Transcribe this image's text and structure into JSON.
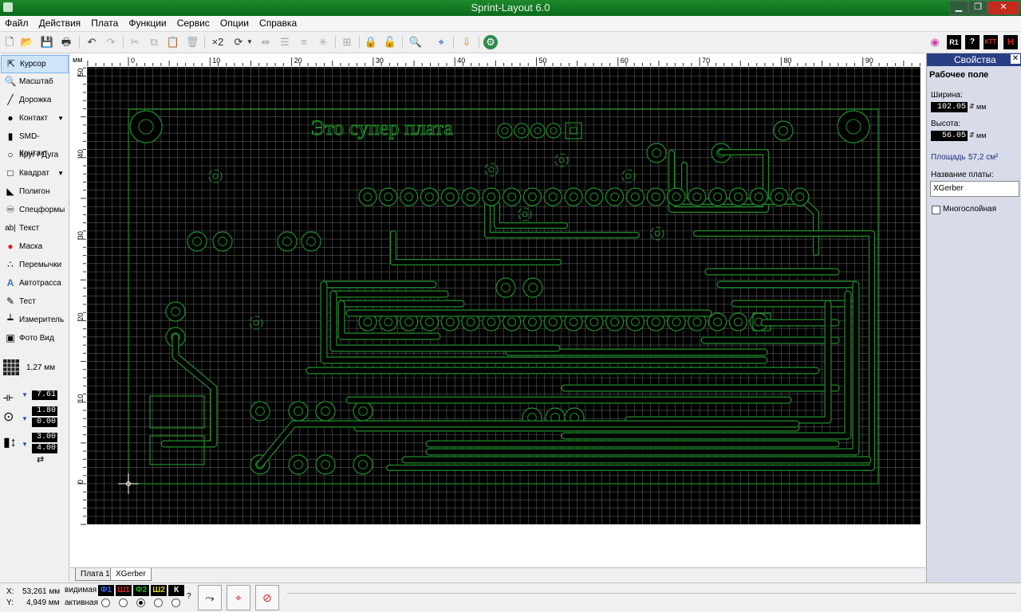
{
  "window": {
    "title": "Sprint-Layout 6.0"
  },
  "menu": [
    "Файл",
    "Действия",
    "Плата",
    "Функции",
    "Сервис",
    "Опции",
    "Справка"
  ],
  "toolbar": {
    "multiply_label": "×2"
  },
  "tools": [
    {
      "label": "Курсор",
      "icon": "cursor-icon"
    },
    {
      "label": "Масштаб",
      "icon": "zoom-icon"
    },
    {
      "label": "Дорожка",
      "icon": "track-icon"
    },
    {
      "label": "Контакт",
      "icon": "pad-icon"
    },
    {
      "label": "SMD-Контакт",
      "icon": "smd-pad-icon"
    },
    {
      "label": "Круг / Дуга",
      "icon": "circle-icon"
    },
    {
      "label": "Квадрат",
      "icon": "square-icon"
    },
    {
      "label": "Полигон",
      "icon": "polygon-icon"
    },
    {
      "label": "Спецформы",
      "icon": "special-shape-icon"
    },
    {
      "label": "Текст",
      "icon": "text-icon"
    },
    {
      "label": "Маска",
      "icon": "mask-icon"
    },
    {
      "label": "Перемычки",
      "icon": "jumper-icon"
    },
    {
      "label": "Автотрасса",
      "icon": "autoroute-icon"
    },
    {
      "label": "Тест",
      "icon": "test-icon"
    },
    {
      "label": "Измеритель",
      "icon": "ruler-icon"
    },
    {
      "label": "Фото Вид",
      "icon": "photo-view-icon"
    }
  ],
  "grid": {
    "label": "1,27 мм"
  },
  "track_width": "7.61",
  "pad_outer": "1.80",
  "pad_inner": "0.00",
  "smd_w": "3.00",
  "smd_h": "4.00",
  "ruler": {
    "unit": "мм",
    "x_ticks": [
      "0",
      "10",
      "20",
      "30",
      "40",
      "50",
      "60",
      "70",
      "80",
      "90"
    ],
    "y_ticks": [
      "50",
      "40",
      "30",
      "20",
      "10",
      "0"
    ]
  },
  "board": {
    "text": "Это супер плата"
  },
  "properties": {
    "title": "Свойства",
    "section": "Рабочее поле",
    "width_label": "Ширина:",
    "width_value": "102.05",
    "height_label": "Высота:",
    "height_value": "56.05",
    "unit": "мм",
    "area_label": "Площадь",
    "area_value": "57,2 см²",
    "name_label": "Название платы:",
    "name_value": "XGerber",
    "multilayer_label": "Многослойная"
  },
  "tabs": [
    "Плата 1",
    "XGerber"
  ],
  "status": {
    "x_label": "X:",
    "x_value": "53,261 мм",
    "y_label": "Y:",
    "y_value": "4,949 мм",
    "visible_label": "видимая",
    "active_label": "активная",
    "help": "?",
    "layers": [
      {
        "name": "Ф1",
        "bg": "#000000",
        "fg": "#3b6cff"
      },
      {
        "name": "Ш1",
        "bg": "#000000",
        "fg": "#e02020"
      },
      {
        "name": "Ф2",
        "bg": "#000000",
        "fg": "#1fb51f"
      },
      {
        "name": "Ш2",
        "bg": "#000000",
        "fg": "#d8d820"
      },
      {
        "name": "К",
        "bg": "#000000",
        "fg": "#ffffff"
      }
    ]
  },
  "colors": {
    "board_bg": "#000000",
    "trace": "#1f8f2a",
    "grid": "#5a5a5a"
  }
}
